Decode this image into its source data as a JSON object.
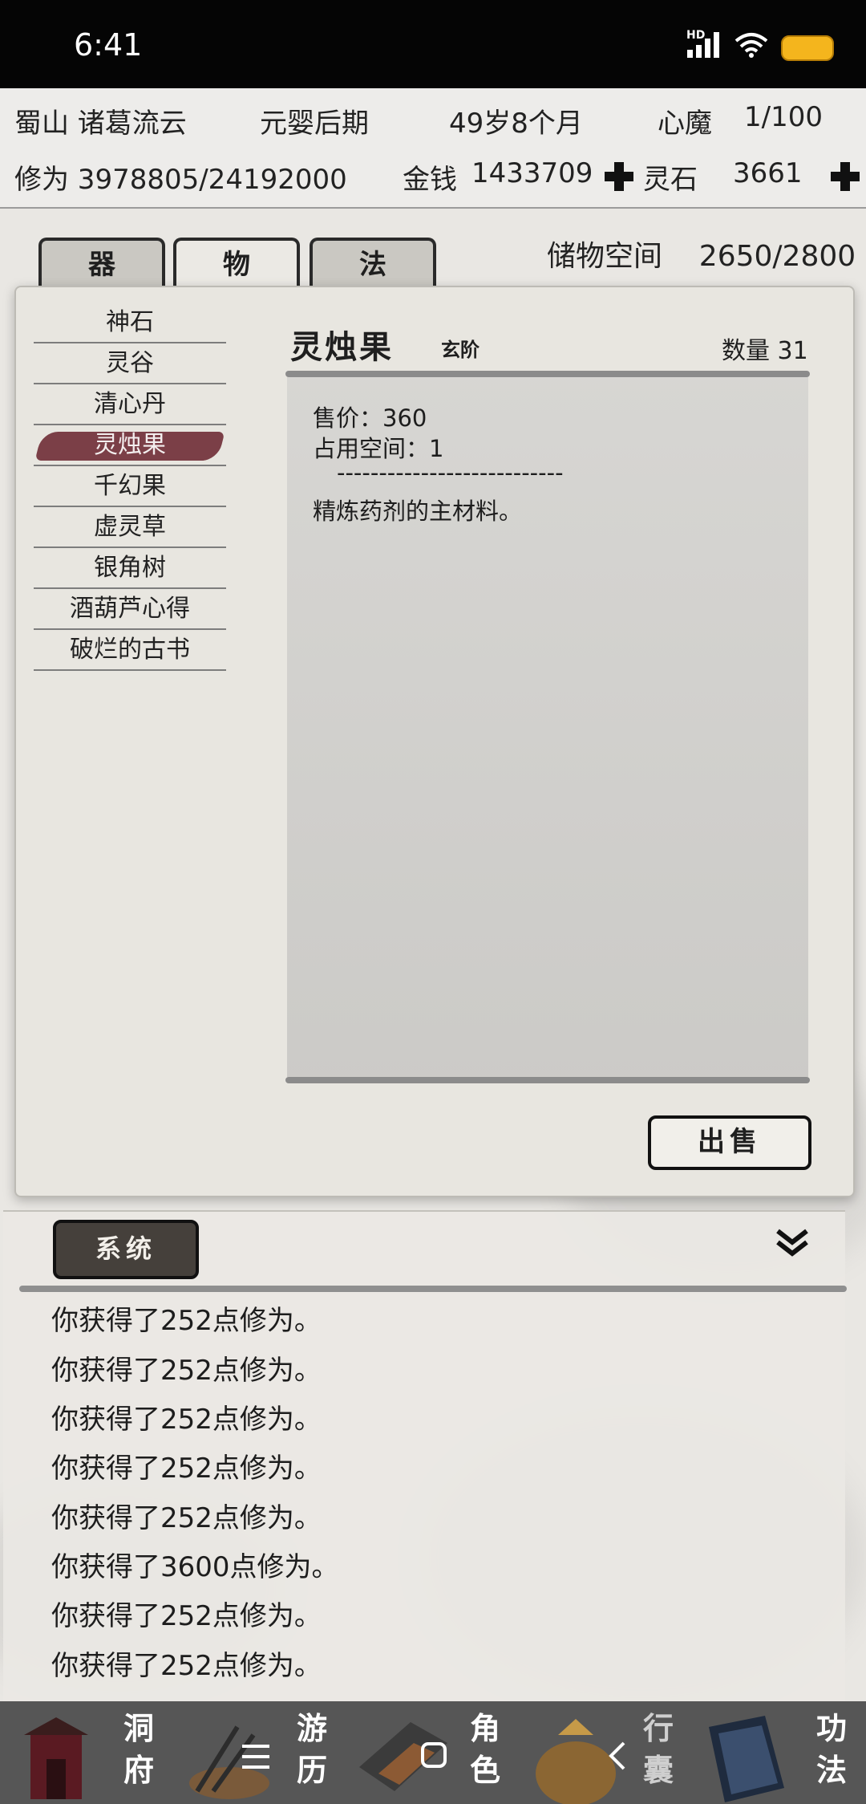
{
  "status_bar": {
    "time": "6:41",
    "hd": "HD"
  },
  "header": {
    "location_name": "蜀山 诸葛流云",
    "realm": "元婴后期",
    "age": "49岁8个月",
    "demon_label": "心魔",
    "demon_value": "1/100",
    "cultivation": "修为 3978805/24192000",
    "money_label": "金钱",
    "money_value": "1433709",
    "spirit_stone_label": "灵石",
    "spirit_stone_value": "3661"
  },
  "tabs": [
    "器",
    "物",
    "法"
  ],
  "active_tab": "物",
  "storage": {
    "label": "储物空间",
    "value": "2650/2800"
  },
  "items": [
    "神石",
    "灵谷",
    "清心丹",
    "灵烛果",
    "千幻果",
    "虚灵草",
    "银角树",
    "酒葫芦心得",
    "破烂的古书"
  ],
  "selected_item": "灵烛果",
  "detail": {
    "name": "灵烛果",
    "grade": "玄阶",
    "quantity": "数量 31",
    "price": "售价：360",
    "space": "占用空间：1",
    "divider": "---------------------------",
    "description": "精炼药剂的主材料。"
  },
  "sell_button": "出售",
  "system_tab": "系统",
  "log": [
    "你获得了252点修为。",
    "你获得了252点修为。",
    "你获得了252点修为。",
    "你获得了252点修为。",
    "你获得了252点修为。",
    "你获得了3600点修为。",
    "你获得了252点修为。",
    "你获得了252点修为。"
  ],
  "bottom_nav": [
    {
      "label": "洞府",
      "icon": "palace-icon"
    },
    {
      "label": "游历",
      "icon": "travel-icon"
    },
    {
      "label": "角色",
      "icon": "character-icon"
    },
    {
      "label": "行囊",
      "icon": "bag-icon"
    },
    {
      "label": "功法",
      "icon": "book-icon"
    }
  ],
  "colors": {
    "selected_item": "#7b3f47",
    "system_tab": "#45403b",
    "battery": "#f4b51d"
  }
}
